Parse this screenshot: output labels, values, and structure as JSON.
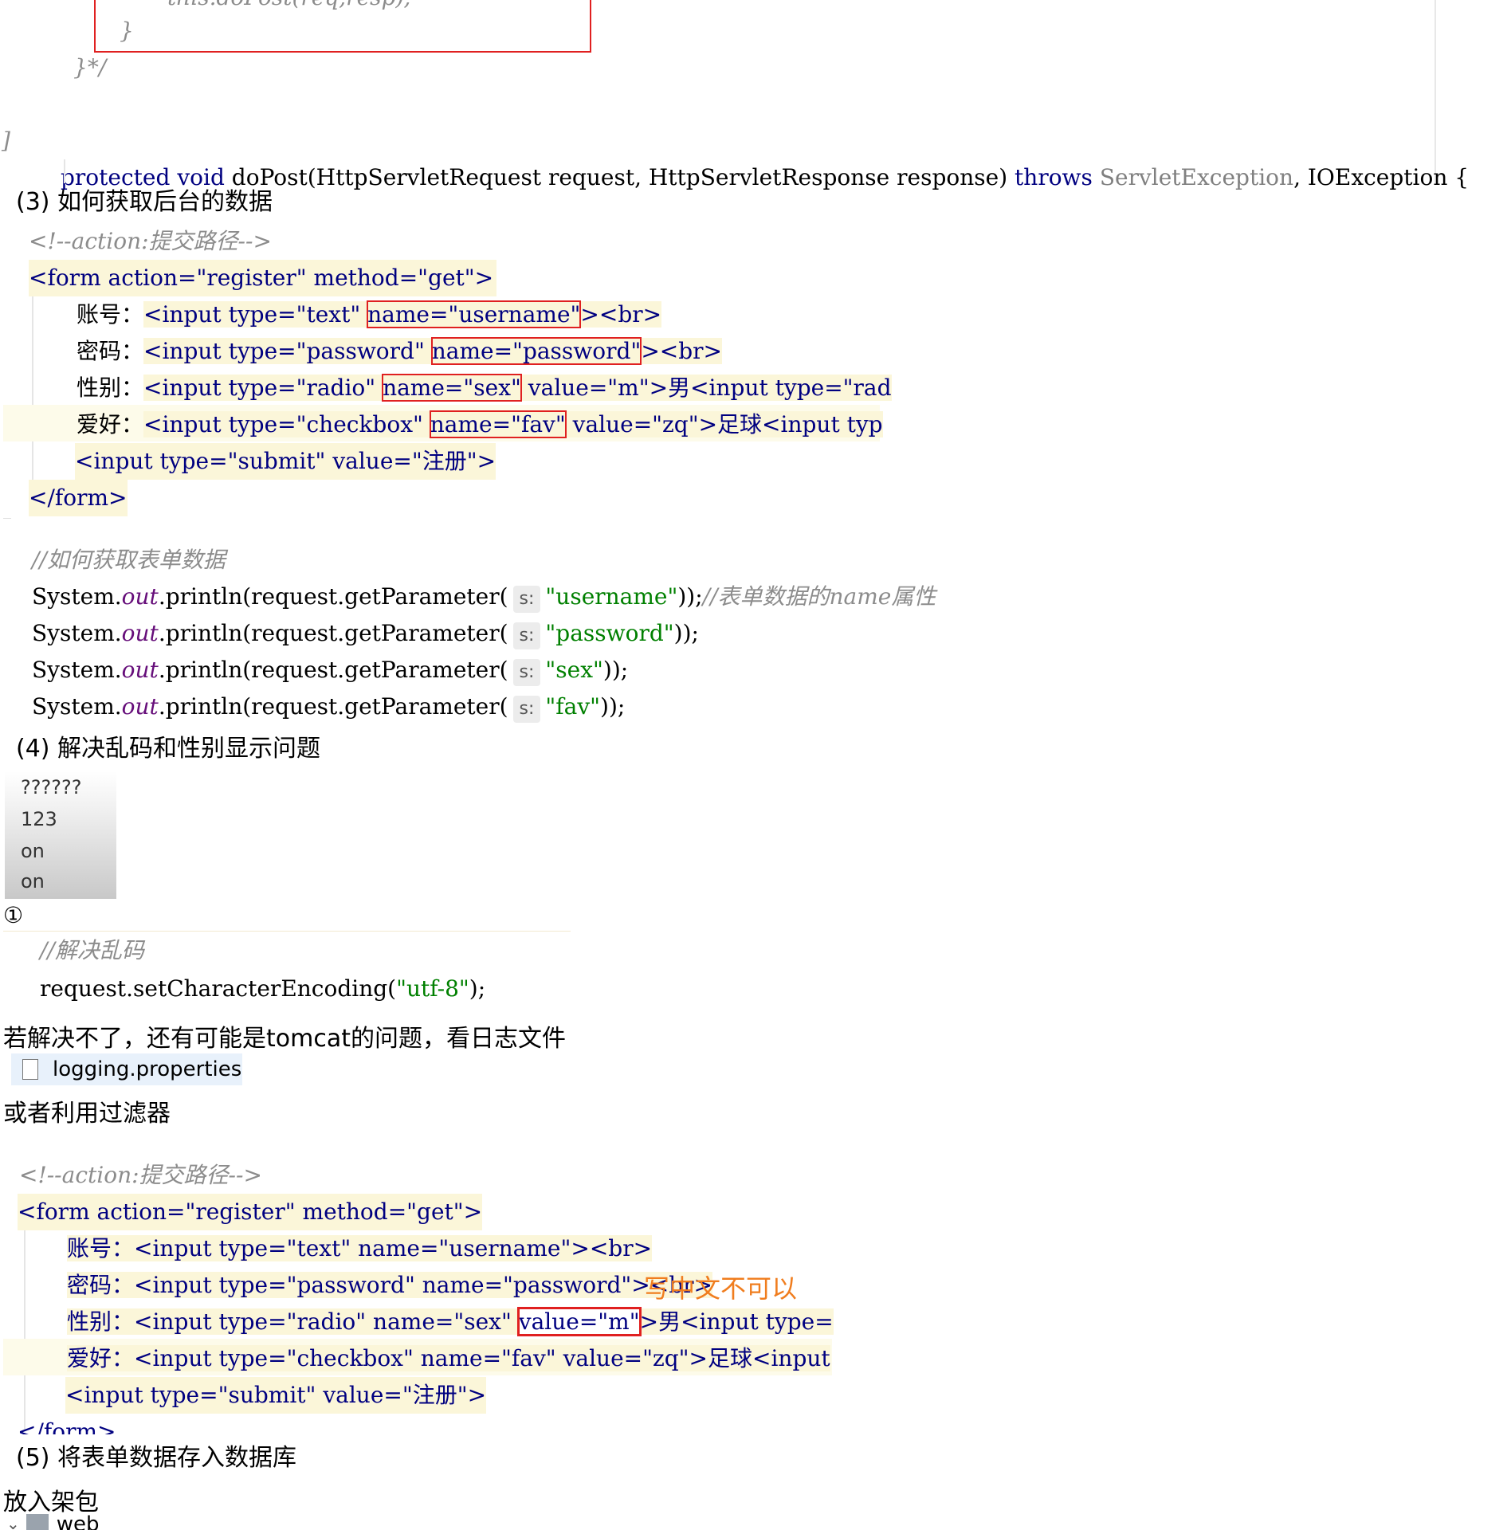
{
  "top_code": {
    "line1": "this.doPost(req,resp);",
    "close1": "}",
    "close2": "}*/",
    "sig": {
      "protected": "protected",
      "void": "void",
      "method": "doPost(HttpServletRequest request, HttpServletResponse response)",
      "throws": "throws",
      "ex1": "ServletException",
      "comma": ",",
      "ex2": "IOException {"
    }
  },
  "section3": {
    "heading": "(3) 如何获取后台的数据",
    "comment": "<!--action:提交路径-->",
    "form_open": "<form action=\"register\" method=\"get\">",
    "rows": [
      {
        "label": "账号：",
        "pre": "<input type=\"text\" ",
        "boxed": "name=\"username\"",
        "post": "><br>"
      },
      {
        "label": "密码：",
        "pre": "<input type=\"password\" ",
        "boxed": "name=\"password\"",
        "post": "><br>"
      },
      {
        "label": "性别：",
        "pre": "<input type=\"radio\" ",
        "boxed": "name=\"sex\"",
        "post": " value=\"m\">男<input type=\"rad"
      },
      {
        "label": "爱好：",
        "pre": "<input type=\"checkbox\" ",
        "boxed": "name=\"fav\"",
        "post": " value=\"zq\">足球<input typ"
      }
    ],
    "submit": "<input type=\"submit\" value=\"注册\">",
    "form_close": "</form>",
    "java_comment": "//如何获取表单数据",
    "println_prefix": "System.",
    "println_out": "out",
    "println_mid": ".println(request.getParameter(",
    "hint": "s:",
    "params": [
      {
        "arg": "\"username\"",
        "tail": "));",
        "comment": "//表单数据的name属性"
      },
      {
        "arg": "\"password\"",
        "tail": "));",
        "comment": ""
      },
      {
        "arg": "\"sex\"",
        "tail": "));",
        "comment": ""
      },
      {
        "arg": "\"fav\"",
        "tail": "));",
        "comment": ""
      }
    ]
  },
  "section4": {
    "heading": "(4) 解决乱码和性别显示问题",
    "output_lines": [
      "??????",
      "123",
      "on",
      "on"
    ],
    "circled": "①",
    "fix_comment": "//解决乱码",
    "fix_code_pre": "request.setCharacterEncoding(",
    "fix_code_arg": "\"utf-8\"",
    "fix_code_post": ");",
    "note1": "若解决不了，还有可能是tomcat的问题，看日志文件",
    "file_name": "logging.properties",
    "note2": "或者利用过滤器",
    "comment2": "<!--action:提交路径-->",
    "form_open2": "<form action=\"register\" method=\"get\">",
    "rows2": [
      "账号：<input type=\"text\" name=\"username\"><br>",
      "密码：<input type=\"password\" name=\"password\"><br>",
      "性别：<input type=\"radio\" name=\"sex\" ",
      "爱好：<input type=\"checkbox\" name=\"fav\" value=\"zq\">足球<input"
    ],
    "radio_boxed": "value=\"m\"",
    "radio_post": ">男<input type=",
    "annotation": "写中文不可以",
    "submit2": "<input type=\"submit\" value=\"注册\">",
    "form_close2": "</form>"
  },
  "section5": {
    "heading": "(5) 将表单数据存入数据库",
    "note": "放入架包",
    "folder": "web"
  },
  "colors": {
    "keyword": "#000080",
    "string": "#008000",
    "comment": "#8c8c8c",
    "box": "#e02020",
    "annotation": "#f07d1e"
  }
}
